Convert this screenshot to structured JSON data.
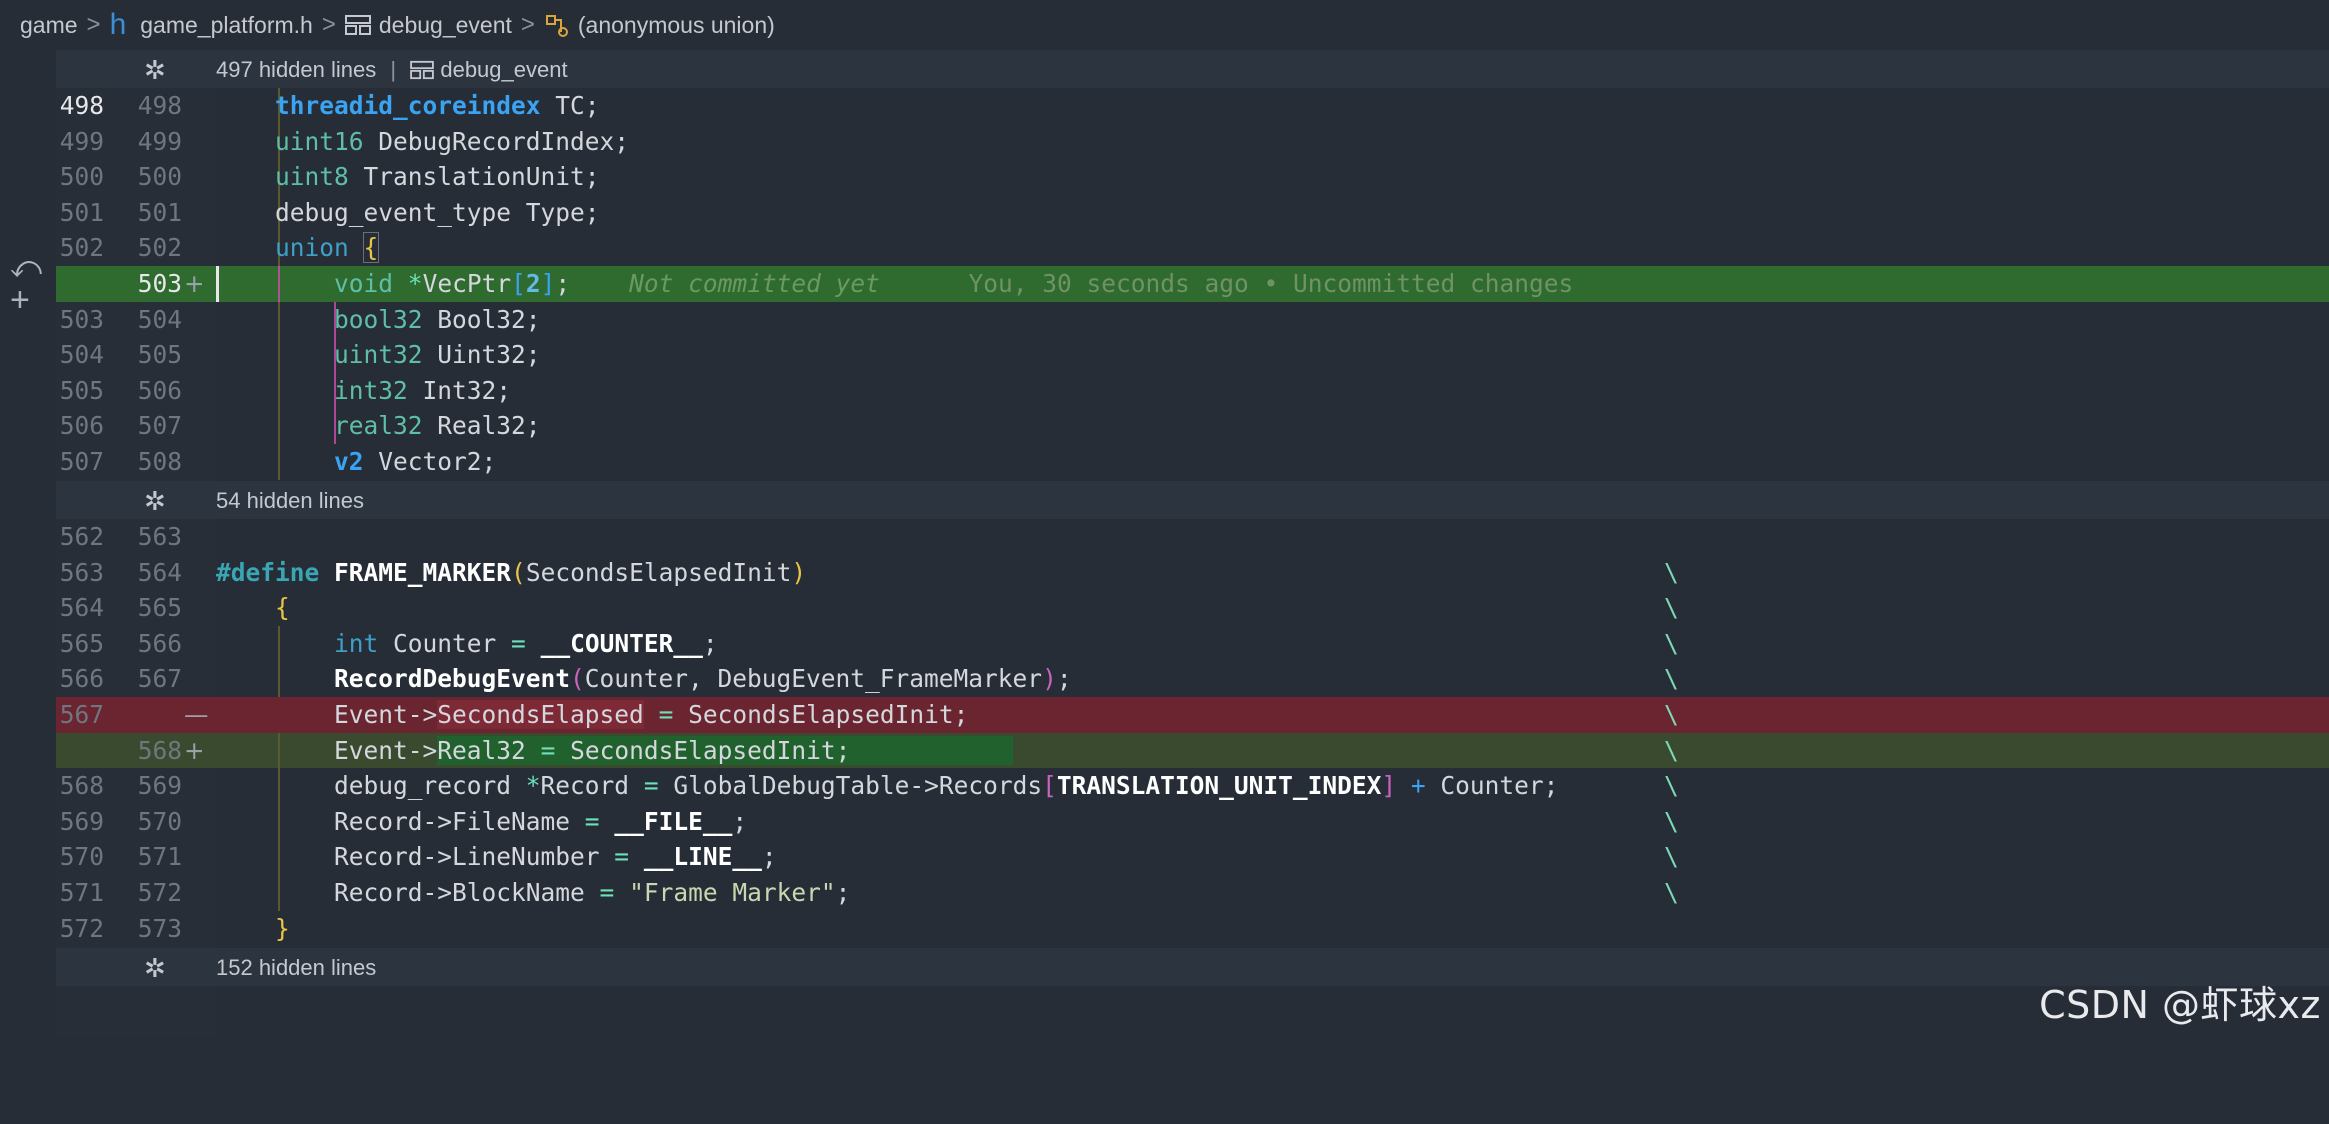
{
  "breadcrumb": {
    "items": [
      "game",
      "game_platform.h",
      "debug_event",
      "(anonymous union)"
    ],
    "separator": ">"
  },
  "hidden_bars": [
    {
      "text": "497 hidden lines",
      "separator": "|",
      "symbol": "debug_event"
    },
    {
      "text": "54 hidden lines"
    },
    {
      "text": "152 hidden lines"
    }
  ],
  "blame": {
    "message": "Not committed yet",
    "detail": "You, 30 seconds ago • Uncommitted changes"
  },
  "lines": [
    {
      "old": "498",
      "new": "498",
      "marker": ""
    },
    {
      "old": "499",
      "new": "499",
      "marker": ""
    },
    {
      "old": "500",
      "new": "500",
      "marker": ""
    },
    {
      "old": "501",
      "new": "501",
      "marker": ""
    },
    {
      "old": "502",
      "new": "502",
      "marker": ""
    },
    {
      "old": "",
      "new": "503",
      "marker": "+"
    },
    {
      "old": "503",
      "new": "504",
      "marker": ""
    },
    {
      "old": "504",
      "new": "505",
      "marker": ""
    },
    {
      "old": "505",
      "new": "506",
      "marker": ""
    },
    {
      "old": "506",
      "new": "507",
      "marker": ""
    },
    {
      "old": "507",
      "new": "508",
      "marker": ""
    },
    {
      "old": "562",
      "new": "563",
      "marker": ""
    },
    {
      "old": "563",
      "new": "564",
      "marker": ""
    },
    {
      "old": "564",
      "new": "565",
      "marker": ""
    },
    {
      "old": "565",
      "new": "566",
      "marker": ""
    },
    {
      "old": "566",
      "new": "567",
      "marker": ""
    },
    {
      "old": "567",
      "new": "",
      "marker": "—"
    },
    {
      "old": "",
      "new": "568",
      "marker": "+"
    },
    {
      "old": "568",
      "new": "569",
      "marker": ""
    },
    {
      "old": "569",
      "new": "570",
      "marker": ""
    },
    {
      "old": "570",
      "new": "571",
      "marker": ""
    },
    {
      "old": "571",
      "new": "572",
      "marker": ""
    },
    {
      "old": "572",
      "new": "573",
      "marker": ""
    }
  ],
  "code": {
    "l0": [
      "threadid_coreindex",
      " TC;"
    ],
    "l1": [
      "uint16",
      " DebugRecordIndex;"
    ],
    "l2": [
      "uint8",
      " TranslationUnit;"
    ],
    "l3": [
      "debug_event_type Type;"
    ],
    "l4": [
      "union",
      " ",
      "{"
    ],
    "l5": [
      "void",
      " ",
      "*",
      "VecPtr",
      "[",
      "2",
      "]",
      ";"
    ],
    "l6": [
      "bool32",
      " Bool32;"
    ],
    "l7": [
      "uint32",
      " Uint32;"
    ],
    "l8": [
      "int32",
      " Int32;"
    ],
    "l9": [
      "real32",
      " Real32;"
    ],
    "l10": [
      "v2",
      " Vector2;"
    ],
    "l11": [],
    "l12": [
      "#define",
      " ",
      "FRAME_MARKER",
      "(",
      "SecondsElapsedInit",
      ")"
    ],
    "l13": [
      "{"
    ],
    "l14": [
      "int",
      " Counter ",
      "=",
      " ",
      "__COUNTER__",
      ";"
    ],
    "l15": [
      "RecordDebugEvent",
      "(",
      "Counter, DebugEvent_FrameMarker",
      ")",
      ";"
    ],
    "l16": [
      "Event->",
      "SecondsElapsed",
      " ",
      "=",
      " SecondsElapsedInit;"
    ],
    "l17": [
      "Event->",
      "Real32",
      " ",
      "=",
      " SecondsElapsedInit;"
    ],
    "l18": [
      "debug_record ",
      "*",
      "Record ",
      "=",
      " GlobalDebugTable->Records",
      "[",
      "TRANSLATION_UNIT_INDEX",
      "]",
      " ",
      "+",
      " Counter;"
    ],
    "l19": [
      "Record->FileName ",
      "=",
      " ",
      "__FILE__",
      ";"
    ],
    "l20": [
      "Record->LineNumber ",
      "=",
      " ",
      "__LINE__",
      ";"
    ],
    "l21": [
      "Record->BlockName ",
      "=",
      " ",
      "\"Frame Marker\"",
      ";"
    ],
    "l22": [
      "}"
    ],
    "backslash": "\\"
  },
  "watermark": "CSDN @虾球xz",
  "colors": {
    "background": "#262d36",
    "added_line": "#2f6a2f",
    "removed_line": "#6a2530",
    "hidden_bar": "#2c3440"
  },
  "icons": [
    "chevron-right-icon",
    "header-file-icon",
    "struct-icon",
    "union-icon",
    "unfold-icon",
    "revert-icon",
    "add-icon"
  ]
}
